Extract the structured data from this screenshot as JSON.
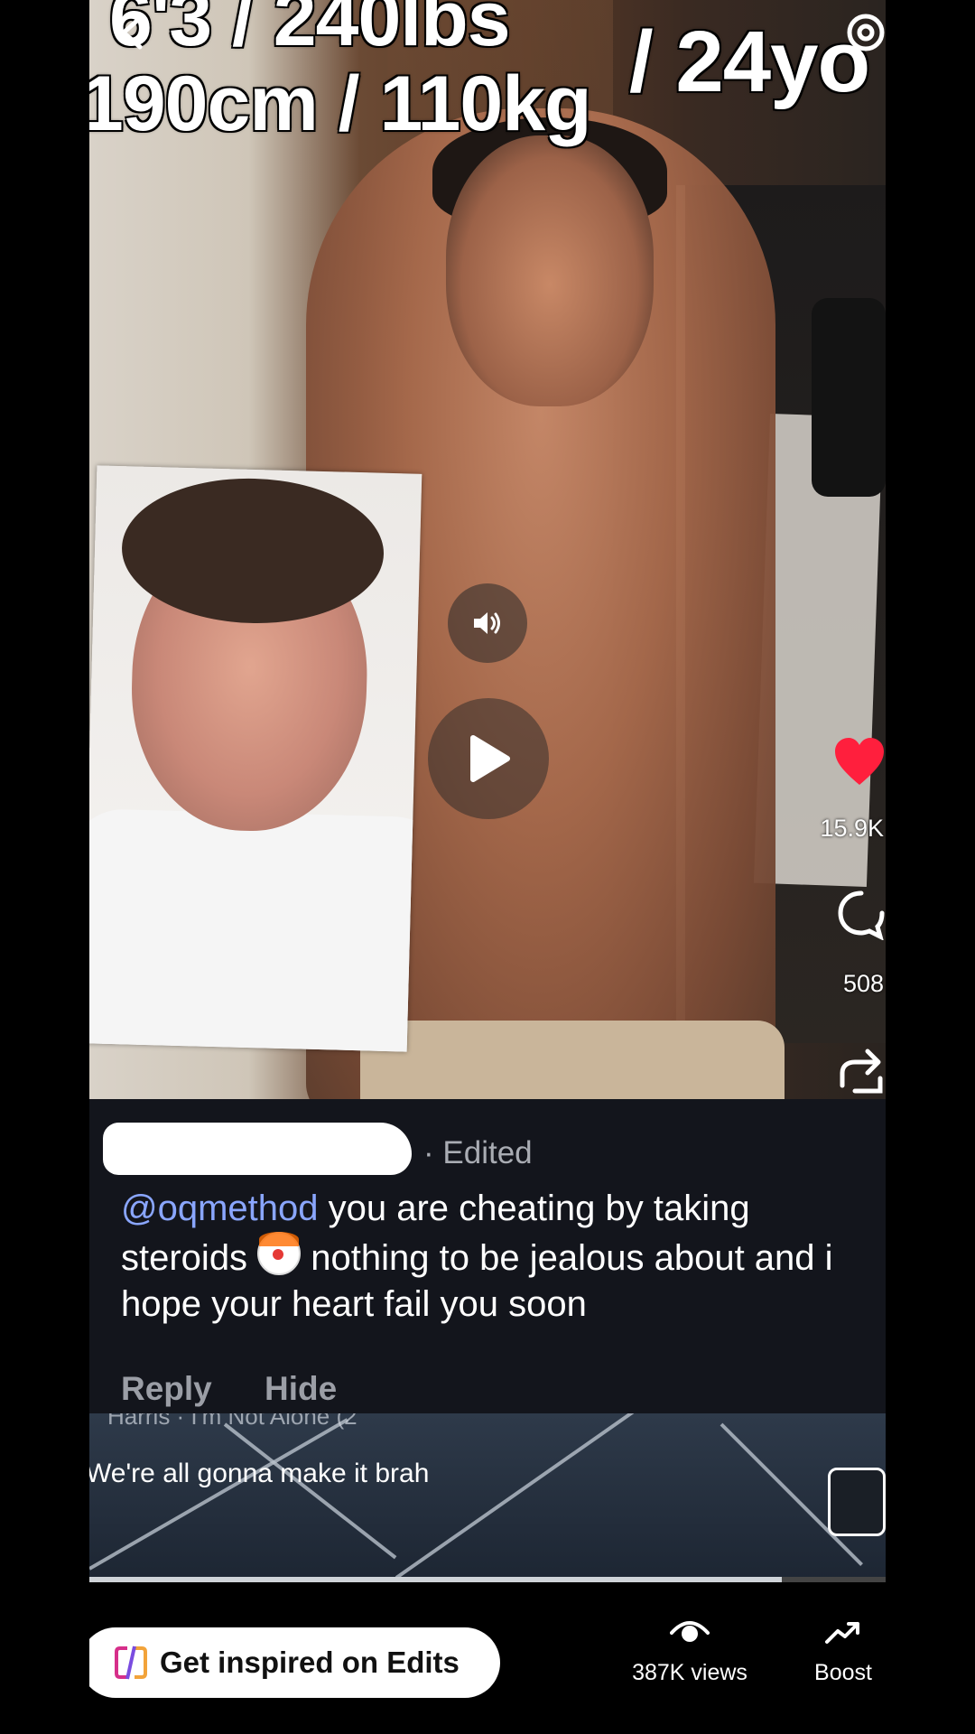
{
  "video": {
    "overlay_line1": "6'3 / 240lbs",
    "overlay_line2": "190cm / 110kg",
    "overlay_line3": "/ 24yo",
    "like_count": "15.9K",
    "comment_count": "508"
  },
  "comment": {
    "edited_label": "· Edited",
    "mention": "@oqmethod",
    "text_part1": " you are cheating by taking steroids",
    "text_part2": " nothing to be jealous about and i hope your heart fail you soon",
    "reply_label": "Reply",
    "hide_label": "Hide"
  },
  "next_video": {
    "music": "Harris · I'm Not Alone (2",
    "caption": "We're all gonna make it brah",
    "progress": 0.87
  },
  "bottom_bar": {
    "edits_label": "Get inspired on Edits",
    "views_label": "387K views",
    "boost_label": "Boost"
  },
  "colors": {
    "mention": "#8aa6ff",
    "like": "#ff1f3d",
    "comment_bg": "#13151c"
  }
}
